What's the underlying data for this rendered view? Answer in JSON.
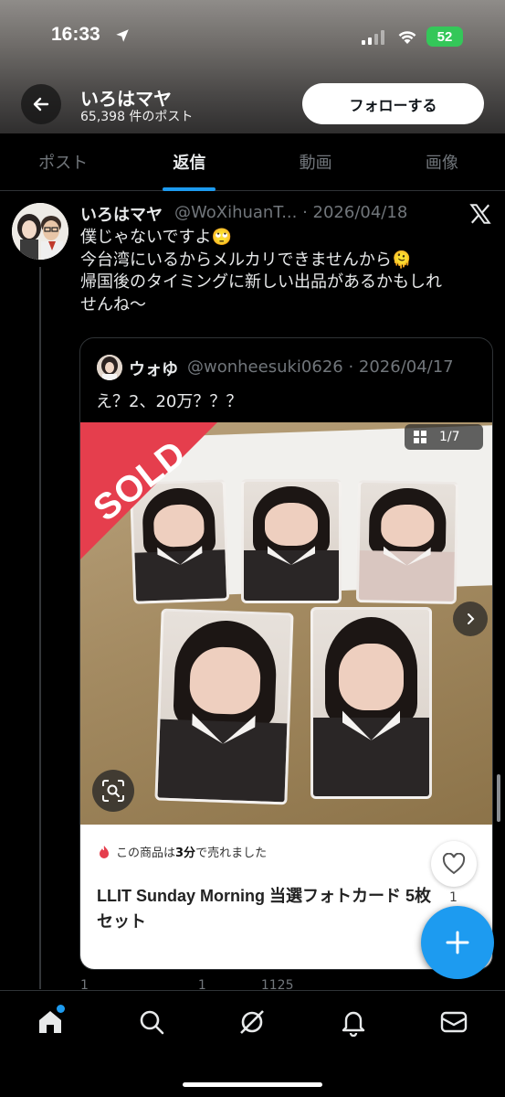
{
  "status_bar": {
    "time": "16:33",
    "battery": "52"
  },
  "header": {
    "name": "いろはマヤ",
    "post_count": "65,398 件のポスト",
    "follow_label": "フォローする"
  },
  "tabs": [
    {
      "label": "ポスト",
      "active": false
    },
    {
      "label": "返信",
      "active": true
    },
    {
      "label": "動画",
      "active": false
    },
    {
      "label": "画像",
      "active": false
    }
  ],
  "tweet": {
    "name": "いろはマヤ",
    "handle_date": "@WoXihuanT... · 2026/04/18",
    "lines": [
      "僕じゃないですよ🙄",
      "今台湾にいるからメルカリできませんから🫠",
      "帰国後のタイミングに新しい出品があるかもしれ",
      "せんね〜"
    ]
  },
  "quote": {
    "name": "ウォゆ",
    "handle_date": "@wonheesuki0626 · 2026/04/17",
    "text": "え？2、20万？？？",
    "sold_label": "SOLD",
    "image_counter": "1/7",
    "sold_note_prefix": "この商品は",
    "sold_note_bold": "3分",
    "sold_note_suffix": "で売れました",
    "item_title": "LLIT Sunday Morning 当選フォトカード 5枚セット",
    "like_count": "1"
  },
  "actions": {
    "replies": "1",
    "reposts": "",
    "likes": "1",
    "views": "1125"
  },
  "colors": {
    "accent": "#1d9bf0",
    "sold_red": "#e53e4d",
    "bg": "#000000"
  },
  "icons": [
    "back-arrow-icon",
    "x-logo-icon",
    "grid-icon",
    "chevron-right-icon",
    "lens-icon",
    "fire-icon",
    "heart-icon",
    "plus-icon",
    "home-icon",
    "search-icon",
    "grok-icon",
    "bell-icon",
    "mail-icon"
  ]
}
